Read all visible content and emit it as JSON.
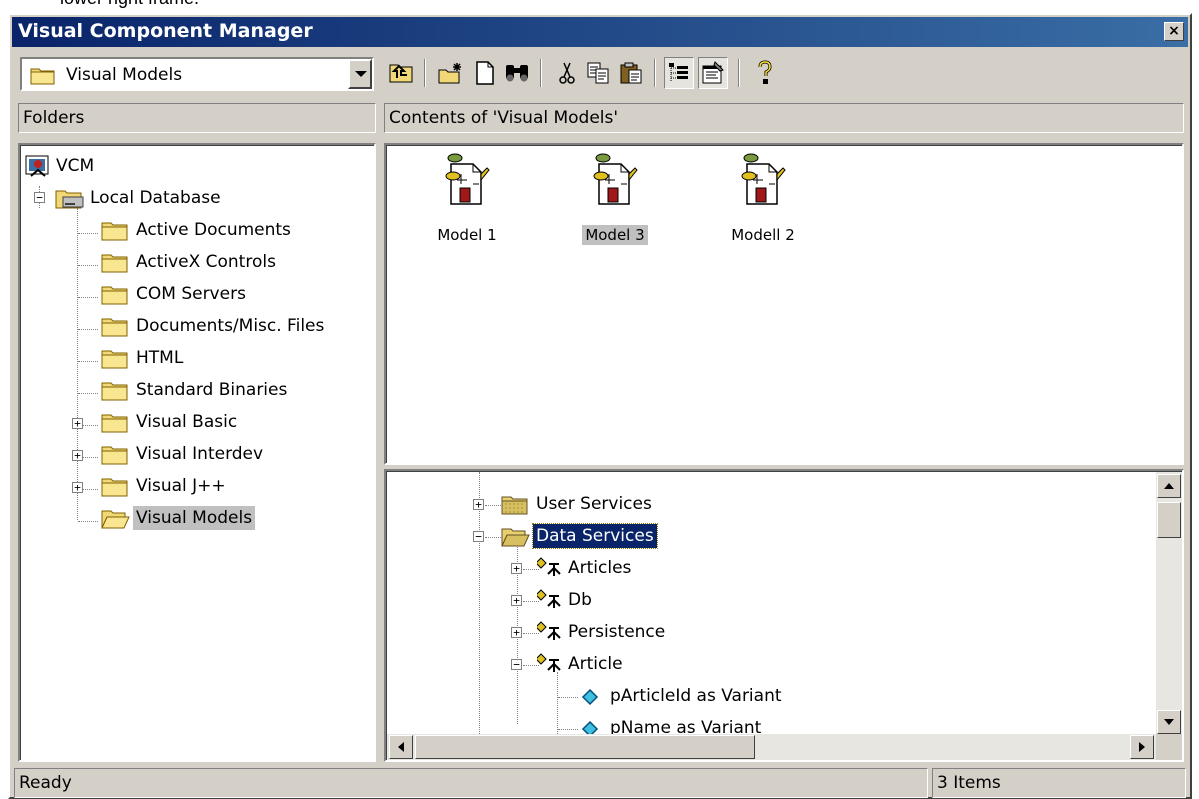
{
  "top_cutoff_text": "lower right frame.",
  "window": {
    "title": "Visual Component Manager",
    "close_label": "×"
  },
  "combo": {
    "value": "Visual Models"
  },
  "toolbar": {
    "buttons": [
      {
        "icon": "up-one-level-icon"
      },
      {
        "icon": "new-folder-icon"
      },
      {
        "icon": "new-document-icon"
      },
      {
        "icon": "find-binoculars-icon"
      },
      {
        "icon": "cut-scissors-icon"
      },
      {
        "icon": "copy-icon"
      },
      {
        "icon": "paste-icon"
      },
      {
        "icon": "explorer-view-icon"
      },
      {
        "icon": "properties-icon"
      },
      {
        "icon": "help-icon"
      }
    ]
  },
  "folders_header": "Folders",
  "contents_header": "Contents of 'Visual Models'",
  "folder_tree": [
    {
      "label": "VCM"
    },
    {
      "label": "Local Database"
    },
    {
      "label": "Active Documents"
    },
    {
      "label": "ActiveX Controls"
    },
    {
      "label": "COM Servers"
    },
    {
      "label": "Documents/Misc. Files"
    },
    {
      "label": "HTML"
    },
    {
      "label": "Standard Binaries"
    },
    {
      "label": "Visual Basic"
    },
    {
      "label": "Visual Interdev"
    },
    {
      "label": "Visual J++"
    },
    {
      "label": "Visual Models"
    }
  ],
  "models": [
    {
      "label": "Model 1"
    },
    {
      "label": "Model 3"
    },
    {
      "label": "Modell 2"
    }
  ],
  "model_tree": [
    {
      "label": "User Services"
    },
    {
      "label": "Data Services"
    },
    {
      "label": "Articles"
    },
    {
      "label": "Db"
    },
    {
      "label": "Persistence"
    },
    {
      "label": "Article"
    },
    {
      "label": "pArticleId as Variant"
    },
    {
      "label": "pName as Variant"
    }
  ],
  "status": {
    "left": "Ready",
    "right": "3 Items"
  },
  "colors": {
    "title_start": "#0a246a",
    "title_end": "#3a6ea5",
    "face": "#d4d0c8",
    "folder": "#f0d878"
  }
}
